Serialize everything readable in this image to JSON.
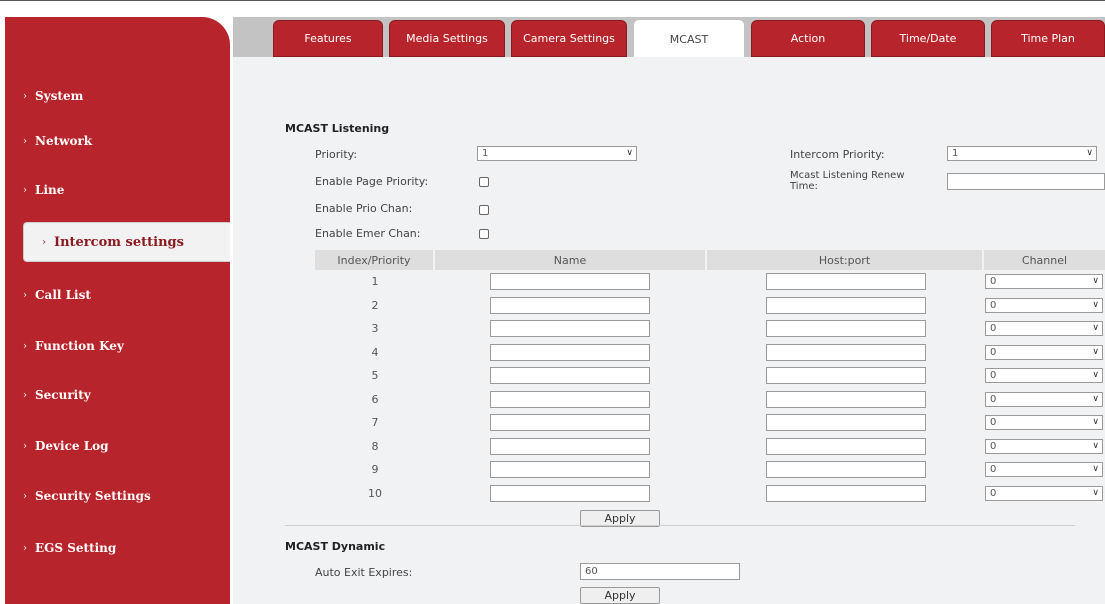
{
  "sidebar": {
    "items": [
      {
        "label": "System"
      },
      {
        "label": "Network"
      },
      {
        "label": "Line"
      },
      {
        "label": "Intercom settings"
      },
      {
        "label": "Call List"
      },
      {
        "label": "Function Key"
      },
      {
        "label": "Security"
      },
      {
        "label": "Device Log"
      },
      {
        "label": "Security Settings"
      },
      {
        "label": "EGS Setting"
      }
    ],
    "active_index": 3
  },
  "tabs": [
    {
      "label": "Features"
    },
    {
      "label": "Media Settings"
    },
    {
      "label": "Camera Settings"
    },
    {
      "label": "MCAST"
    },
    {
      "label": "Action"
    },
    {
      "label": "Time/Date"
    },
    {
      "label": "Time Plan"
    }
  ],
  "active_tab": "MCAST",
  "listening": {
    "title": "MCAST Listening",
    "priority_label": "Priority:",
    "priority_value": "1",
    "intercom_priority_label": "Intercom Priority:",
    "intercom_priority_value": "1",
    "enable_page_priority_label": "Enable Page Priority:",
    "renew_time_label": "Mcast Listening Renew Time:",
    "renew_time_value": "",
    "enable_prio_chan_label": "Enable Prio Chan:",
    "enable_emer_chan_label": "Enable Emer Chan:"
  },
  "table": {
    "headers": [
      "Index/Priority",
      "Name",
      "Host:port",
      "Channel"
    ],
    "rows": [
      {
        "index": "1",
        "name": "",
        "host": "",
        "channel": "0"
      },
      {
        "index": "2",
        "name": "",
        "host": "",
        "channel": "0"
      },
      {
        "index": "3",
        "name": "",
        "host": "",
        "channel": "0"
      },
      {
        "index": "4",
        "name": "",
        "host": "",
        "channel": "0"
      },
      {
        "index": "5",
        "name": "",
        "host": "",
        "channel": "0"
      },
      {
        "index": "6",
        "name": "",
        "host": "",
        "channel": "0"
      },
      {
        "index": "7",
        "name": "",
        "host": "",
        "channel": "0"
      },
      {
        "index": "8",
        "name": "",
        "host": "",
        "channel": "0"
      },
      {
        "index": "9",
        "name": "",
        "host": "",
        "channel": "0"
      },
      {
        "index": "10",
        "name": "",
        "host": "",
        "channel": "0"
      }
    ],
    "apply_label": "Apply"
  },
  "dynamic": {
    "title": "MCAST Dynamic",
    "auto_exit_label": "Auto Exit Expires:",
    "auto_exit_value": "60",
    "apply_label": "Apply"
  },
  "colors": {
    "brand_red": "#b8242b",
    "content_bg": "#f0f2f4"
  }
}
